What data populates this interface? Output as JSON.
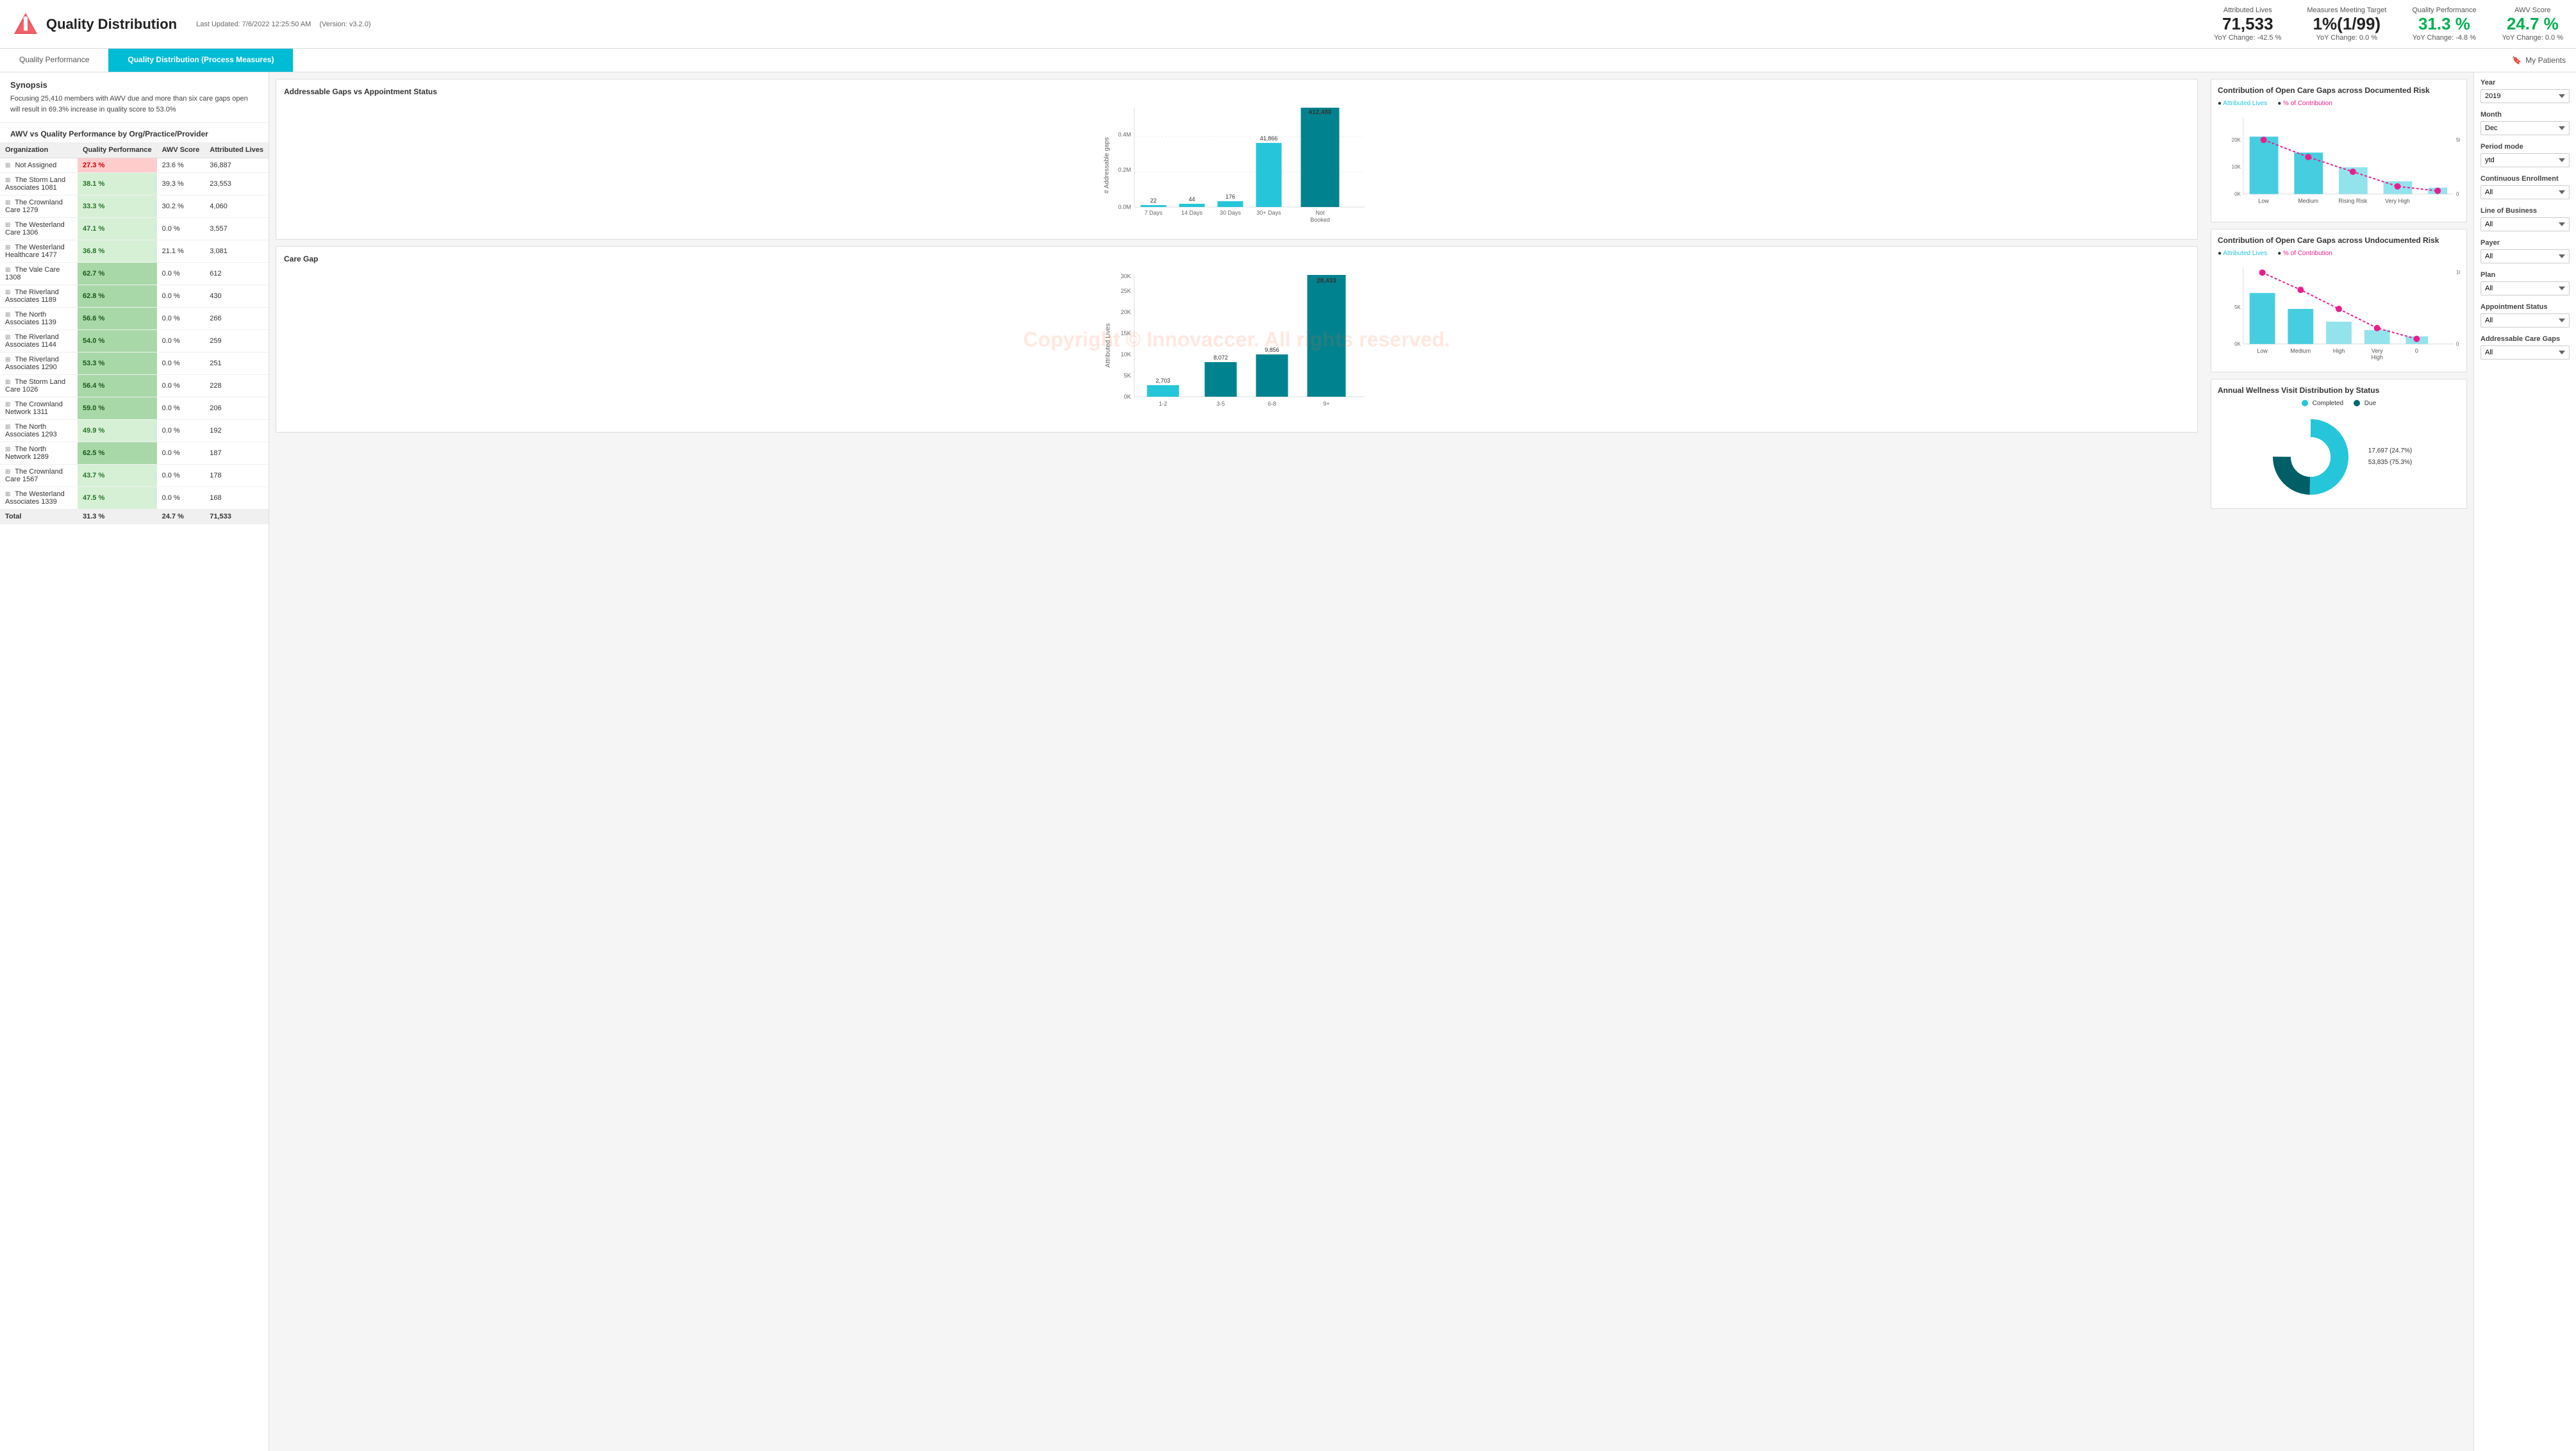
{
  "header": {
    "title": "Quality Distribution",
    "last_updated": "Last Updated: 7/6/2022 12:25:50 AM",
    "version": "(Version: v3.2.0)",
    "stats": [
      {
        "label": "Attributed Lives",
        "value": "71,533",
        "change": "YoY Change: -42.5 %",
        "green": false
      },
      {
        "label": "Measures Meeting Target",
        "value": "1%(1/99)",
        "change": "YoY Change: 0.0 %",
        "green": false
      },
      {
        "label": "Quality Performance",
        "value": "31.3 %",
        "change": "YoY Change: -4.8 %",
        "green": true
      },
      {
        "label": "AWV Score",
        "value": "24.7 %",
        "change": "YoY Change: 0.0 %",
        "green": true
      }
    ]
  },
  "tabs": [
    {
      "label": "Quality Performance",
      "active": false
    },
    {
      "label": "Quality Distribution (Process Measures)",
      "active": true
    },
    {
      "label": "My Patients",
      "active": false
    }
  ],
  "synopsis": {
    "title": "Synopsis",
    "text": "Focusing 25,410 members with AWV due and more than six care gaps open will result in 69.3% increase in quality score to 53.0%"
  },
  "table": {
    "title": "AWV vs Quality Performance by Org/Practice/Provider",
    "columns": [
      "Organization",
      "Quality Performance",
      "AWV Score",
      "Attributed Lives"
    ],
    "rows": [
      {
        "org": "Not Assigned",
        "qp": "27.3 %",
        "awv": "23.6 %",
        "lives": "36,887",
        "qp_class": "red"
      },
      {
        "org": "The Storm Land Associates 1081",
        "qp": "38.1 %",
        "awv": "39.3 %",
        "lives": "23,553",
        "qp_class": "light-green"
      },
      {
        "org": "The Crownland Care 1279",
        "qp": "33.3 %",
        "awv": "30.2 %",
        "lives": "4,060",
        "qp_class": "light-green"
      },
      {
        "org": "The Westerland Care 1306",
        "qp": "47.1 %",
        "awv": "0.0 %",
        "lives": "3,557",
        "qp_class": "light-green"
      },
      {
        "org": "The Westerland Healthcare 1477",
        "qp": "36.8 %",
        "awv": "21.1 %",
        "lives": "3,081",
        "qp_class": "light-green"
      },
      {
        "org": "The Vale Care 1308",
        "qp": "62.7 %",
        "awv": "0.0 %",
        "lives": "612",
        "qp_class": "medium-green"
      },
      {
        "org": "The Riverland Associates 1189",
        "qp": "62.8 %",
        "awv": "0.0 %",
        "lives": "430",
        "qp_class": "medium-green"
      },
      {
        "org": "The North Associates 1139",
        "qp": "56.6 %",
        "awv": "0.0 %",
        "lives": "266",
        "qp_class": "medium-green"
      },
      {
        "org": "The Riverland Associates 1144",
        "qp": "54.0 %",
        "awv": "0.0 %",
        "lives": "259",
        "qp_class": "medium-green"
      },
      {
        "org": "The Riverland Associates 1290",
        "qp": "53.3 %",
        "awv": "0.0 %",
        "lives": "251",
        "qp_class": "medium-green"
      },
      {
        "org": "The Storm Land Care 1026",
        "qp": "56.4 %",
        "awv": "0.0 %",
        "lives": "228",
        "qp_class": "medium-green"
      },
      {
        "org": "The Crownland Network 1311",
        "qp": "59.0 %",
        "awv": "0.0 %",
        "lives": "206",
        "qp_class": "medium-green"
      },
      {
        "org": "The North Associates 1293",
        "qp": "49.9 %",
        "awv": "0.0 %",
        "lives": "192",
        "qp_class": "light-green"
      },
      {
        "org": "The North Network 1289",
        "qp": "62.5 %",
        "awv": "0.0 %",
        "lives": "187",
        "qp_class": "medium-green"
      },
      {
        "org": "The Crownland Care 1567",
        "qp": "43.7 %",
        "awv": "0.0 %",
        "lives": "178",
        "qp_class": "light-green"
      },
      {
        "org": "The Westerland Associates 1339",
        "qp": "47.5 %",
        "awv": "0.0 %",
        "lives": "168",
        "qp_class": "light-green"
      },
      {
        "org": "Total",
        "qp": "31.3 %",
        "awv": "24.7 %",
        "lives": "71,533",
        "qp_class": ""
      }
    ]
  },
  "charts": {
    "addressable_gaps": {
      "title": "Addressable Gaps vs Appointment Status",
      "bars": [
        {
          "label": "7 Days",
          "value": 22,
          "height_pct": 2
        },
        {
          "label": "14 Days",
          "value": 44,
          "height_pct": 3
        },
        {
          "label": "30 Days",
          "value": 176,
          "height_pct": 5
        },
        {
          "label": "30+ Days",
          "value": 41866,
          "height_pct": 68
        },
        {
          "label": "Not Booked",
          "value": 412480,
          "height_pct": 100
        }
      ],
      "y_labels": [
        "0.0M",
        "0.2M",
        "0.4M"
      ],
      "x_axis_label": "# Addressable gaps"
    },
    "care_gap": {
      "title": "Care Gap",
      "bars": [
        {
          "label": "1-2",
          "value": 2703,
          "height_pct": 28
        },
        {
          "label": "3-5",
          "value": 8072,
          "height_pct": 83
        },
        {
          "label": "6-8",
          "value": 9856,
          "height_pct": 100
        },
        {
          "label": "9+",
          "value": 28433,
          "height_pct": 100,
          "tall": true
        }
      ],
      "y_labels": [
        "0K",
        "5K",
        "10K",
        "15K",
        "20K",
        "25K",
        "30K"
      ],
      "x_axis_label": "Attributed Lives",
      "note_value": "28,433"
    },
    "documented_risk": {
      "title": "Contribution of Open Care Gaps across Documented Risk",
      "x_labels": [
        "Low",
        "Medium",
        "Rising Risk",
        "Very High"
      ],
      "bars": [
        60,
        45,
        25,
        15,
        8
      ],
      "line_pcts": [
        48,
        30,
        15,
        5,
        2
      ]
    },
    "undocumented_risk": {
      "title": "Contribution of Open Care Gaps across Undocumented Risk",
      "x_labels": [
        "Low",
        "Medium",
        "High",
        "Very High",
        "0"
      ],
      "bars": [
        55,
        35,
        20,
        12,
        5
      ],
      "line_pcts": [
        95,
        60,
        30,
        15,
        5
      ]
    },
    "awv_distribution": {
      "title": "Annual Wellness Visit Distribution by Status",
      "legend": [
        "Completed",
        "Due"
      ],
      "completed_pct": 75.3,
      "due_pct": 24.7,
      "completed_label": "53,835 (75.3%)",
      "due_label": "17,697 (24.7%)"
    }
  },
  "filters": {
    "year": {
      "label": "Year",
      "value": "2019"
    },
    "month": {
      "label": "Month",
      "value": "Dec"
    },
    "period_mode": {
      "label": "Period mode",
      "value": "ytd"
    },
    "continuous_enrollment": {
      "label": "Continuous Enrollment",
      "value": "All"
    },
    "line_of_business": {
      "label": "Line of Business",
      "value": "All"
    },
    "payer": {
      "label": "Payer",
      "value": "All"
    },
    "plan": {
      "label": "Plan",
      "value": "All"
    },
    "appointment_status": {
      "label": "Appointment Status",
      "value": "All"
    },
    "addressable_care_gaps": {
      "label": "Addressable Care Gaps",
      "value": "All"
    }
  },
  "watermark": "Copyright © Innovaccer. All rights reserved."
}
